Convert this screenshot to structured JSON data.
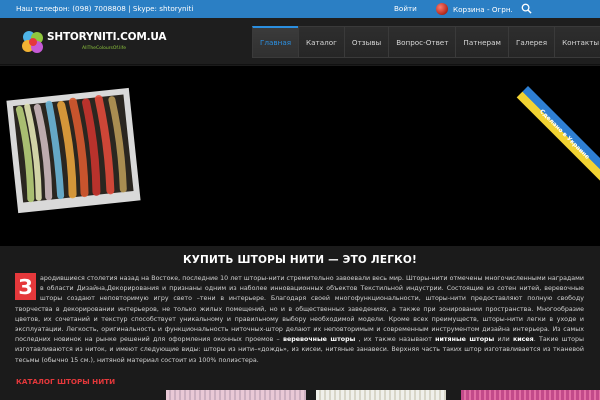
{
  "topbar": {
    "contact": "Наш телефон: (098) 7008808 | Skype: shtoryniti",
    "login": "Войти",
    "cart": "Корзина - Огрн."
  },
  "logo": {
    "text": "SHTORYNITI.COM.UA",
    "subtext": "AllTheColoursOf.life"
  },
  "nav": [
    {
      "label": "Главная",
      "active": true
    },
    {
      "label": "Каталог"
    },
    {
      "label": "Отзывы"
    },
    {
      "label": "Вопрос-Ответ"
    },
    {
      "label": "Патнерам"
    },
    {
      "label": "Галерея"
    },
    {
      "label": "Контакты"
    }
  ],
  "ribbon": {
    "text": "Сделано в Украине"
  },
  "article": {
    "headline": "КУПИТЬ ШТОРЫ НИТИ — ЭТО ЛЕГКО!",
    "dropcap": "З",
    "body_lead": "ародившиеся столетия назад на Востоке, последние 10 лет шторы-нити стремительно завоевали весь мир. Шторы-нити отмечены многочисленными наградами в области Дизайна,Декорирования и признаны одним из наболее инновационных объектов Текстильной индустрии. Состоящие из сотен нитей, веревочные шторы создают неповторимую игру свето –тени в интерьере. Благодаря своей многофункциональности, шторы-нити предоставляют полную свободу творчества в декорировании интерьеров, не только жилых помещений, но и в общественных заведениях, а также при зонировании пространства. Многообразие цветов, их сочетаний и текстур способствует уникальному и правильному выбору необходимой модели. Кроме всех преимуществ, шторы-нити легки в уходе и эксплуатации. Легкость, оригинальность и функциональность ниточных-штор делают их неповторимым и современным инструментом дизайна интерьера. Из самых последних новинок на рынке решений для оформления оконных проемов –",
    "bold_1": "веревочные шторы",
    "text_2": ", их также называют",
    "bold_2": "нитяные шторы",
    "text_3": "или",
    "bold_3": "кисея",
    "body_tail": ". Такие шторы изготавливаются из ниток, и имеют следующие виды: шторы из нити–«дождь», из кисеи, нитяные занавеси. Верхняя часть таких штор изготавливается из тканевой тесьмы (обычно 15 см.), нитяной материал состоит из 100% полиэстера."
  },
  "catalog": {
    "title": "КАТАЛОГ ШТОРЫ НИТИ"
  },
  "colors": {
    "topbar": "#2b7fc4",
    "accent_red": "#e5383b",
    "nav_active": "#2b8fe0"
  }
}
